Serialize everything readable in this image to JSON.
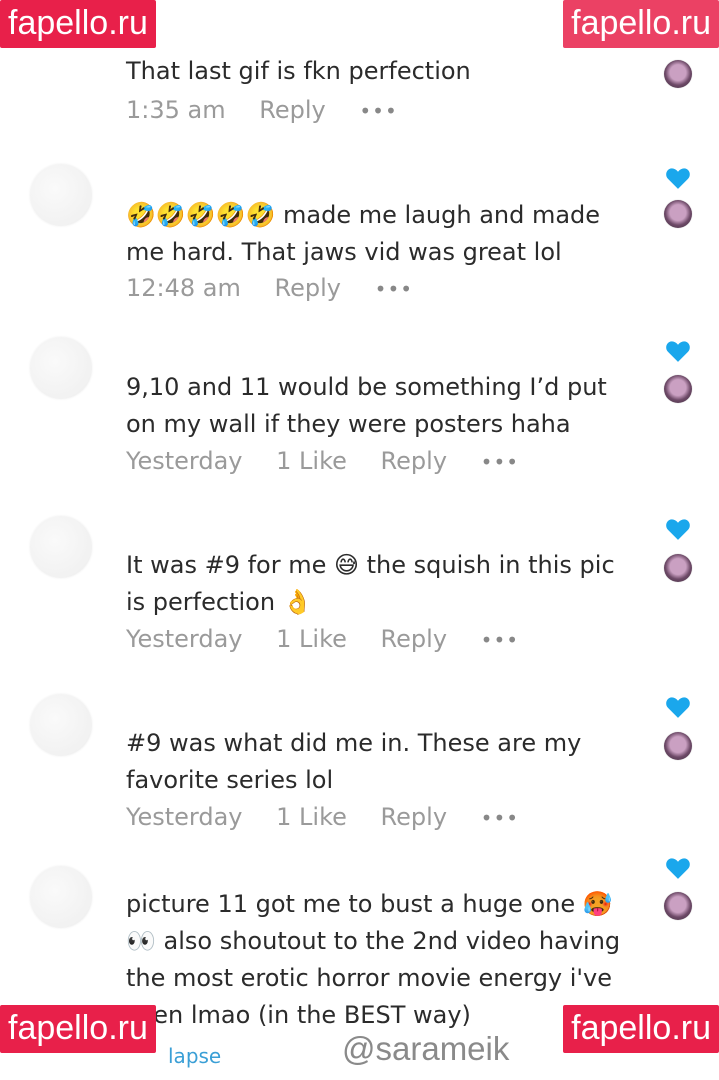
{
  "watermarks": [
    "fapello.ru",
    "fapello.ru",
    "fapello.ru",
    "fapello.ru"
  ],
  "footer": {
    "collapse_label": "lapse",
    "handle": "@sarameik"
  },
  "comments": [
    {
      "text": "That last gif is fkn perfection",
      "time": "1:35 am",
      "likes": "",
      "reply": "Reply",
      "more": "•••",
      "liked_by_creator": false
    },
    {
      "text": "🤣🤣🤣🤣🤣 made me laugh and made me hard. That jaws vid was great lol",
      "time": "12:48 am",
      "likes": "",
      "reply": "Reply",
      "more": "•••",
      "liked_by_creator": true
    },
    {
      "text": "9,10 and 11 would be something I’d put on my wall if they were posters haha",
      "time": "Yesterday",
      "likes": "1 Like",
      "reply": "Reply",
      "more": "•••",
      "liked_by_creator": true
    },
    {
      "text": "It was #9 for me 😅 the squish in this pic is perfection 👌",
      "time": "Yesterday",
      "likes": "1 Like",
      "reply": "Reply",
      "more": "•••",
      "liked_by_creator": true
    },
    {
      "text": "#9 was what did me in. These are my fa­vorite series lol",
      "time": "Yesterday",
      "likes": "1 Like",
      "reply": "Reply",
      "more": "•••",
      "liked_by_creator": true
    },
    {
      "text": "picture 11 got me to bust a huge one 🥵👀 also shoutout to the 2nd video having the most erotic horror movie energy i've seen lmao (in the BEST way)",
      "time": "",
      "likes": "",
      "reply": "",
      "more": "",
      "liked_by_creator": true
    }
  ],
  "colors": {
    "heart": "#1aa7ec",
    "watermark_bg": "#e8204a",
    "meta_text": "#9a9a9a",
    "link": "#3a9fd6"
  },
  "icons": {
    "heart": "heart-icon",
    "avatar": "avatar",
    "more": "more-icon"
  }
}
